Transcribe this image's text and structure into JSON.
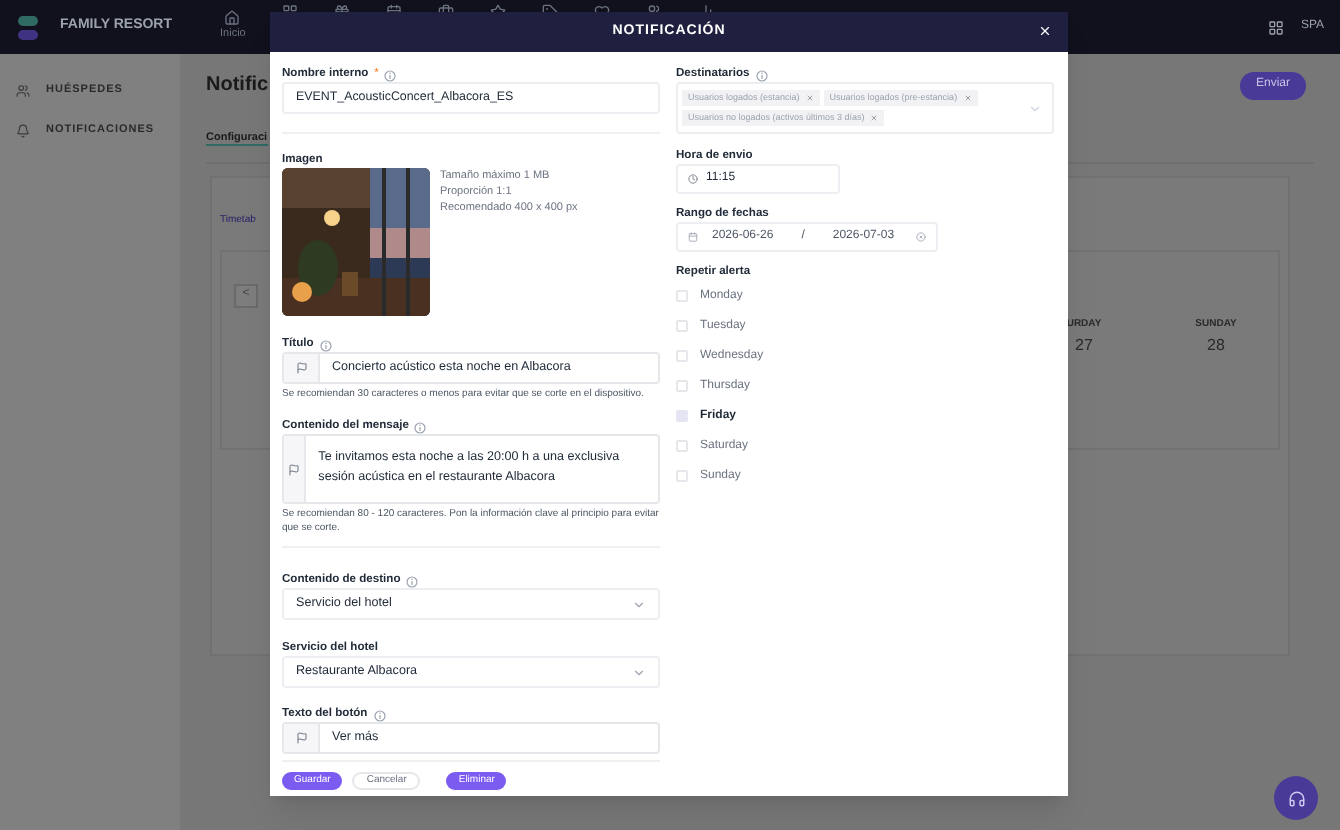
{
  "app_bar": {
    "brand": "FAMILY RESORT",
    "nav": [
      {
        "label": "Inicio"
      }
    ],
    "language": "SPA"
  },
  "sidebar": {
    "items": [
      {
        "label": "HUÉSPEDES",
        "kind": "guests"
      },
      {
        "label": "NOTIFICACIONES",
        "kind": "bell"
      }
    ]
  },
  "page": {
    "title": "Notific",
    "tab": "Configuraci",
    "sub_tab": "Timetab",
    "send_button": "Enviar",
    "prev_button": "<",
    "calendar_headers": [
      {
        "day": "URDAY",
        "date": "27"
      },
      {
        "day": "SUNDAY",
        "date": "28"
      }
    ]
  },
  "modal": {
    "title": "NOTIFICACIÓN",
    "internal_name": {
      "label": "Nombre interno",
      "required_mark": "*",
      "value": "EVENT_AcousticConcert_Albacora_ES"
    },
    "image": {
      "label": "Imagen",
      "specs": [
        "Tamaño máximo 1 MB",
        "Proporción 1:1",
        "Recomendado 400 x 400 px"
      ]
    },
    "title_field": {
      "label": "Título",
      "value": "Concierto acústico esta noche en Albacora",
      "hint": "Se recomiendan 30 caracteres o menos para evitar que se corte en el dispositivo."
    },
    "message": {
      "label": "Contenido del mensaje",
      "value": "Te invitamos esta noche a las 20:00 h a una exclusiva sesión acústica en el restaurante Albacora",
      "hint": "Se recomiendan 80 - 120 caracteres. Pon la información clave al principio para evitar que se corte."
    },
    "destination": {
      "label": "Contenido de destino",
      "value": "Servicio del hotel"
    },
    "hotel_service": {
      "label": "Servicio del hotel",
      "value": "Restaurante Albacora"
    },
    "button_text": {
      "label": "Texto del botón",
      "value": "Ver más"
    },
    "recipients": {
      "label": "Destinatarios",
      "tags": [
        "Usuarios logados (estancia)",
        "Usuarios logados (pre-estancia)",
        "Usuarios no logados (activos últimos 3 días)"
      ]
    },
    "send_time": {
      "label": "Hora de envio",
      "value": "11:15"
    },
    "date_range": {
      "label": "Rango de fechas",
      "start": "2026-06-26",
      "separator": "/",
      "end": "2026-07-03"
    },
    "repeat": {
      "label": "Repetir alerta",
      "days": [
        {
          "label": "Monday",
          "checked": false
        },
        {
          "label": "Tuesday",
          "checked": false
        },
        {
          "label": "Wednesday",
          "checked": false
        },
        {
          "label": "Thursday",
          "checked": false
        },
        {
          "label": "Friday",
          "checked": true
        },
        {
          "label": "Saturday",
          "checked": false
        },
        {
          "label": "Sunday",
          "checked": false
        }
      ]
    },
    "actions": [
      {
        "label": "Guardar",
        "kind": "primary"
      },
      {
        "label": "Cancelar",
        "kind": "secondary"
      },
      {
        "label": "Eliminar",
        "kind": "primary"
      }
    ]
  }
}
